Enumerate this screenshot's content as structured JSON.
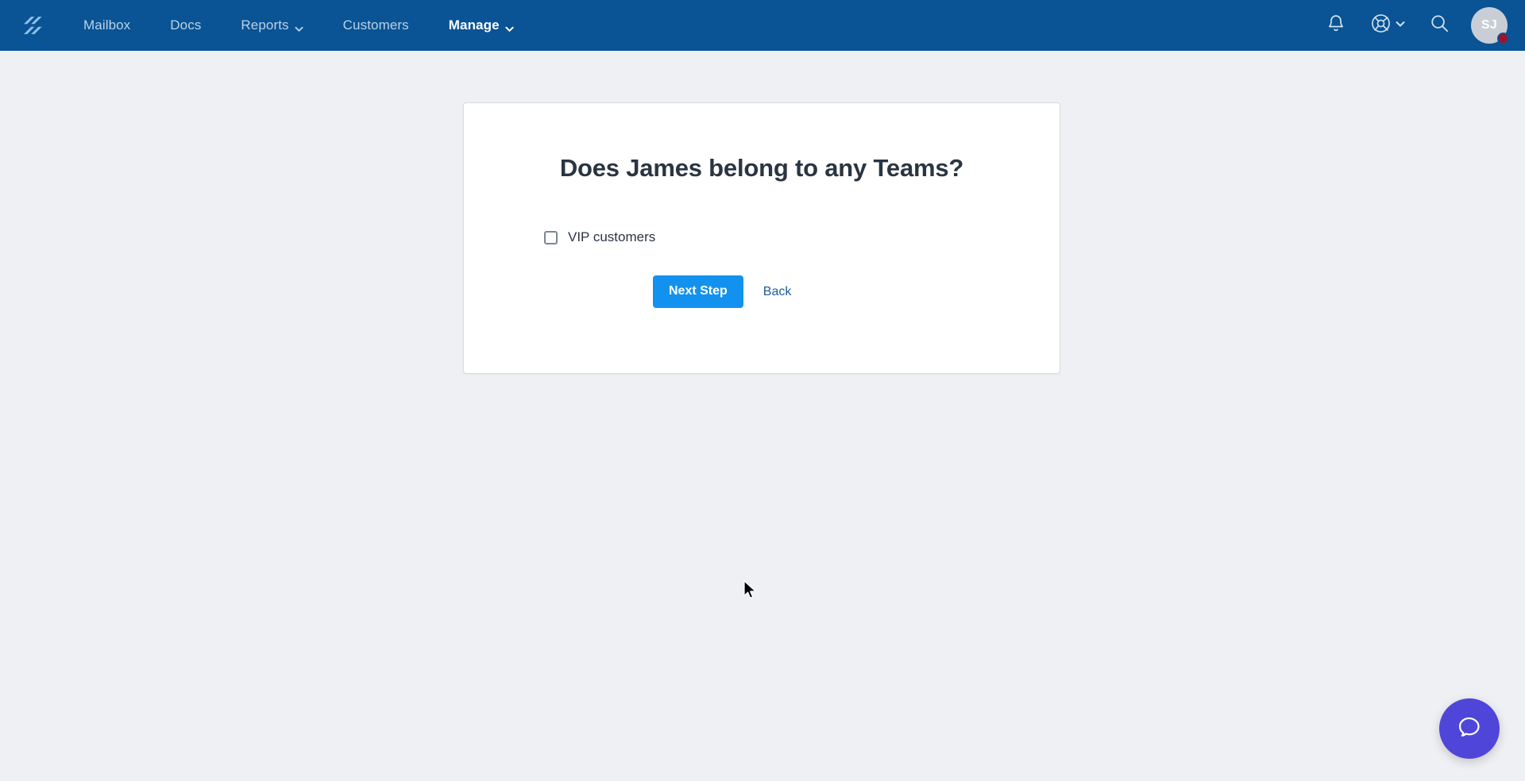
{
  "navbar": {
    "logo_name": "helpscout-logo",
    "links": [
      {
        "label": "Mailbox",
        "has_caret": false,
        "active": false
      },
      {
        "label": "Docs",
        "has_caret": false,
        "active": false
      },
      {
        "label": "Reports",
        "has_caret": true,
        "active": false
      },
      {
        "label": "Customers",
        "has_caret": false,
        "active": false
      },
      {
        "label": "Manage",
        "has_caret": true,
        "active": true
      }
    ],
    "icons": {
      "notifications": "bell-icon",
      "help": "lifebuoy-icon",
      "search": "search-icon"
    },
    "avatar": {
      "initials": "SJ",
      "badge": true
    },
    "colors": {
      "background": "#0a5394",
      "link": "#b9d2e8",
      "link_active": "#ffffff",
      "badge": "#a11228",
      "avatar_bg": "#c9ced6"
    }
  },
  "card": {
    "title": "Does James belong to any Teams?",
    "teams": [
      {
        "label": "VIP customers",
        "checked": false
      }
    ],
    "primary_button": "Next Step",
    "secondary_button": "Back",
    "colors": {
      "surface": "#ffffff",
      "border": "#d9dce0",
      "title": "#2a3542",
      "primary": "#1292ee",
      "link": "#1c5b9c"
    }
  },
  "beacon": {
    "icon": "chat-bubble-icon",
    "color": "#4f46d9"
  },
  "page": {
    "background": "#eff0f3"
  }
}
